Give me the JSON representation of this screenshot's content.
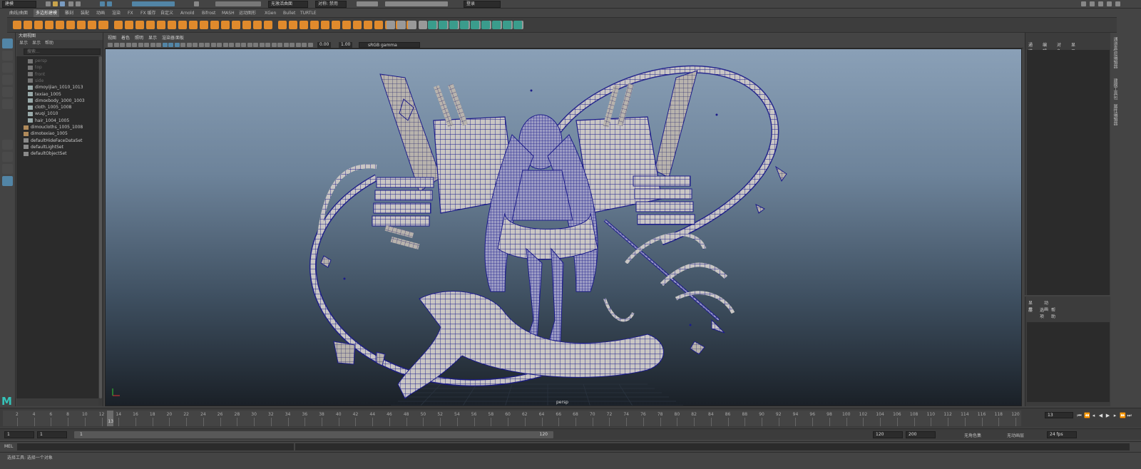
{
  "status_line": {
    "menu_set": "建模",
    "live_surface": "无激活曲面",
    "symmetry": "对称: 禁用",
    "user": "登录"
  },
  "shelf_tabs": [
    "曲线/曲面",
    "多边形建模",
    "雕刻",
    "装配",
    "动画",
    "渲染",
    "FX",
    "FX 缓存",
    "自定义",
    "Arnold",
    "Bifrost",
    "MASH",
    "运动图形",
    "XGen",
    "Bullet",
    "TURTLE"
  ],
  "shelf_active_tab": "多边形建模",
  "outliner": {
    "title": "大纲视图",
    "menu": [
      "显示",
      "显示",
      "帮助"
    ],
    "search_placeholder": "搜索...",
    "items": [
      {
        "label": "persp",
        "type": "camera",
        "dim": true
      },
      {
        "label": "top",
        "type": "camera",
        "dim": true
      },
      {
        "label": "front",
        "type": "camera",
        "dim": true
      },
      {
        "label": "side",
        "type": "camera",
        "dim": true
      },
      {
        "label": "dimoyijian_1010_1013",
        "type": "mesh"
      },
      {
        "label": "texiao_1005",
        "type": "mesh"
      },
      {
        "label": "dimoxbody_1000_1003",
        "type": "mesh"
      },
      {
        "label": "cloth_1005_1008",
        "type": "mesh"
      },
      {
        "label": "wuqi_1010",
        "type": "mesh"
      },
      {
        "label": "hair_1004_1005",
        "type": "mesh"
      },
      {
        "label": "dimoucloths_1005_1008",
        "type": "group"
      },
      {
        "label": "dimotexiao_1005",
        "type": "group"
      },
      {
        "label": "defaultHideFaceDataSet",
        "type": "set"
      },
      {
        "label": "defaultLightSet",
        "type": "set"
      },
      {
        "label": "defaultObjectSet",
        "type": "set"
      }
    ]
  },
  "viewport": {
    "menu": [
      "视图",
      "着色",
      "照明",
      "显示",
      "渲染器",
      "面板"
    ],
    "exposure": "0.00",
    "gamma": "1.00",
    "color_space": "sRGB gamma",
    "camera": "persp"
  },
  "channel_box": {
    "menu": [
      "通道",
      "编辑",
      "对象",
      "显示"
    ]
  },
  "layer_editor": {
    "tabs": [
      "显示",
      "动画"
    ],
    "menu": [
      "层",
      "选项",
      "帮助"
    ]
  },
  "side_tabs": [
    "通道盒/层编辑器",
    "建模工具包",
    "属性编辑器"
  ],
  "timeline": {
    "ticks": [
      2,
      4,
      6,
      8,
      10,
      12,
      14,
      16,
      18,
      20,
      22,
      24,
      26,
      28,
      30,
      32,
      34,
      36,
      38,
      40,
      42,
      44,
      46,
      48,
      50,
      52,
      54,
      56,
      58,
      60,
      62,
      64,
      66,
      68,
      70,
      72,
      74,
      76,
      78,
      80,
      82,
      84,
      86,
      88,
      90,
      92,
      94,
      96,
      98,
      100,
      102,
      104,
      106,
      108,
      110,
      112,
      114,
      116,
      118,
      120
    ],
    "current_frame": "13",
    "start": 1,
    "end": 120
  },
  "range": {
    "start_time": "1",
    "playback_start": "1",
    "range_start_label": "1",
    "range_end_label": "120",
    "playback_end": "120",
    "end_time": "200",
    "character_set": "无角色集",
    "anim_layer": "无动画层",
    "fps": "24 fps"
  },
  "command_line": {
    "label": "MEL",
    "help": "选择工具: 选择一个对象"
  },
  "colors": {
    "accent": "#5285a6",
    "viewport_top": "#8aa0b7",
    "viewport_bottom": "#1a2027",
    "wire": "#1c1c8a",
    "mesh": "#c9c6c4",
    "shelf_orange": "#e08a2c",
    "shelf_teal": "#3a9c8c",
    "maya_logo": "#35c2b8"
  }
}
